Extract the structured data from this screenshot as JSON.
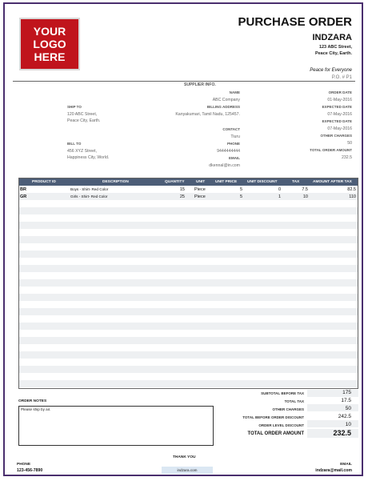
{
  "logo": {
    "line1": "YOUR",
    "line2": "LOGO",
    "line3": "HERE"
  },
  "header": {
    "title": "PURCHASE ORDER",
    "company": "INDZARA",
    "address1": "123 ABC Street,",
    "address2": "Peace City, Earth.",
    "tagline": "Peace for Everyone",
    "po_number": "P.O. # P1"
  },
  "supplier": {
    "heading": "SUPPLIER INFO.",
    "name_label": "NAME",
    "name": "ABC Company",
    "billing_label": "BILLING ADDRESS",
    "billing": "Kanyakumari, Tamil Nadu, 125457.",
    "contact_label": "CONTACT",
    "contact": "Tiuru",
    "phone_label": "PHONE",
    "phone": "9444444444",
    "email_label": "EMAIL",
    "email": "dkennal@in.com"
  },
  "ship_to": {
    "label": "SHIP TO",
    "line1": "120 ABC Street,",
    "line2": "Peace City, Earth."
  },
  "bill_to": {
    "label": "BILL TO",
    "line1": "456 XYZ Street,",
    "line2": "Happiness City, World."
  },
  "order_info": {
    "order_date_label": "ORDER DATE",
    "order_date": "01-May-2016",
    "expected_label_1": "EXPECTED DATE",
    "expected_date_1": "07-May-2016",
    "expected_label_2": "EXPECTED DATE",
    "expected_date_2": "07-May-2016",
    "other_charges_label": "OTHER CHARGES",
    "other_charges": "50",
    "total_order_label": "TOTAL ORDER AMOUNT",
    "total_order": "232.5"
  },
  "table": {
    "headers": [
      "PRODUCT ID",
      "DESCRIPTION",
      "QUANTITY",
      "UNIT",
      "UNIT PRICE",
      "UNIT DISCOUNT",
      "TAX",
      "AMOUNT AFTER TAX"
    ],
    "rows": [
      {
        "id": "BR",
        "desc": "Boys - Shirt- Red Color",
        "qty": "15",
        "unit": "Piece",
        "price": "5",
        "discount": "0",
        "tax": "7.5",
        "amount": "82.5"
      },
      {
        "id": "GR",
        "desc": "Girls - Shirt- Red Color",
        "qty": "25",
        "unit": "Piece",
        "price": "5",
        "discount": "1",
        "tax": "10",
        "amount": "110"
      }
    ]
  },
  "totals": {
    "subtotal_label": "SUBTOTAL BEFORE TAX",
    "subtotal": "175",
    "tax_label": "TOTAL TAX",
    "tax": "17.5",
    "other_label": "OTHER CHARGES",
    "other": "50",
    "before_disc_label": "TOTAL BEFORE ORDER DISCOUNT",
    "before_disc": "242.5",
    "order_disc_label": "ORDER LEVEL DISCOUNT",
    "order_disc": "10",
    "total_label": "TOTAL ORDER AMOUNT",
    "total": "232.5"
  },
  "notes": {
    "label": "ORDER NOTES",
    "text": "Please ship by air."
  },
  "footer": {
    "thanks": "THANK YOU",
    "phone_label": "PHONE",
    "phone": "123-456-7890",
    "website": "indzara.com",
    "email_label": "EMAIL",
    "email": "indzara@mail.com"
  }
}
